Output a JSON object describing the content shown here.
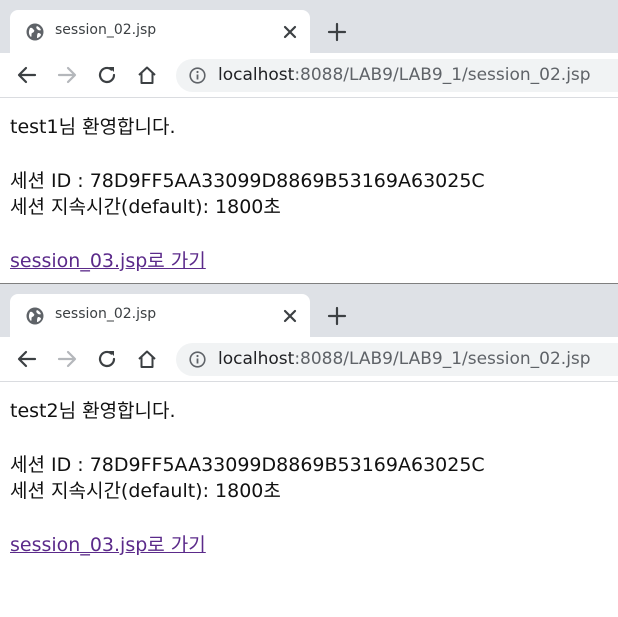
{
  "windows": [
    {
      "tab": {
        "title": "session_02.jsp"
      },
      "address": {
        "host": "localhost",
        "rest": ":8088/LAB9/LAB9_1/session_02.jsp"
      },
      "content": {
        "welcome": "test1님 환영합니다.",
        "session_id": "세션 ID : 78D9FF5AA33099D8869B53169A63025C",
        "session_time": "세션 지속시간(default): 1800초",
        "link": "session_03.jsp로 가기"
      }
    },
    {
      "tab": {
        "title": "session_02.jsp"
      },
      "address": {
        "host": "localhost",
        "rest": ":8088/LAB9/LAB9_1/session_02.jsp"
      },
      "content": {
        "welcome": "test2님 환영합니다.",
        "session_id": "세션 ID : 78D9FF5AA33099D8869B53169A63025C",
        "session_time": "세션 지속시간(default): 1800초",
        "link": "session_03.jsp로 가기"
      }
    }
  ],
  "icons": [
    "globe-icon",
    "close-icon",
    "plus-icon",
    "back-arrow-icon",
    "forward-arrow-icon",
    "reload-icon",
    "home-icon",
    "info-icon"
  ],
  "colors": {
    "tabstrip": "#dee1e6",
    "omnibox": "#f1f3f4",
    "visited_link": "#5b2a8a"
  }
}
